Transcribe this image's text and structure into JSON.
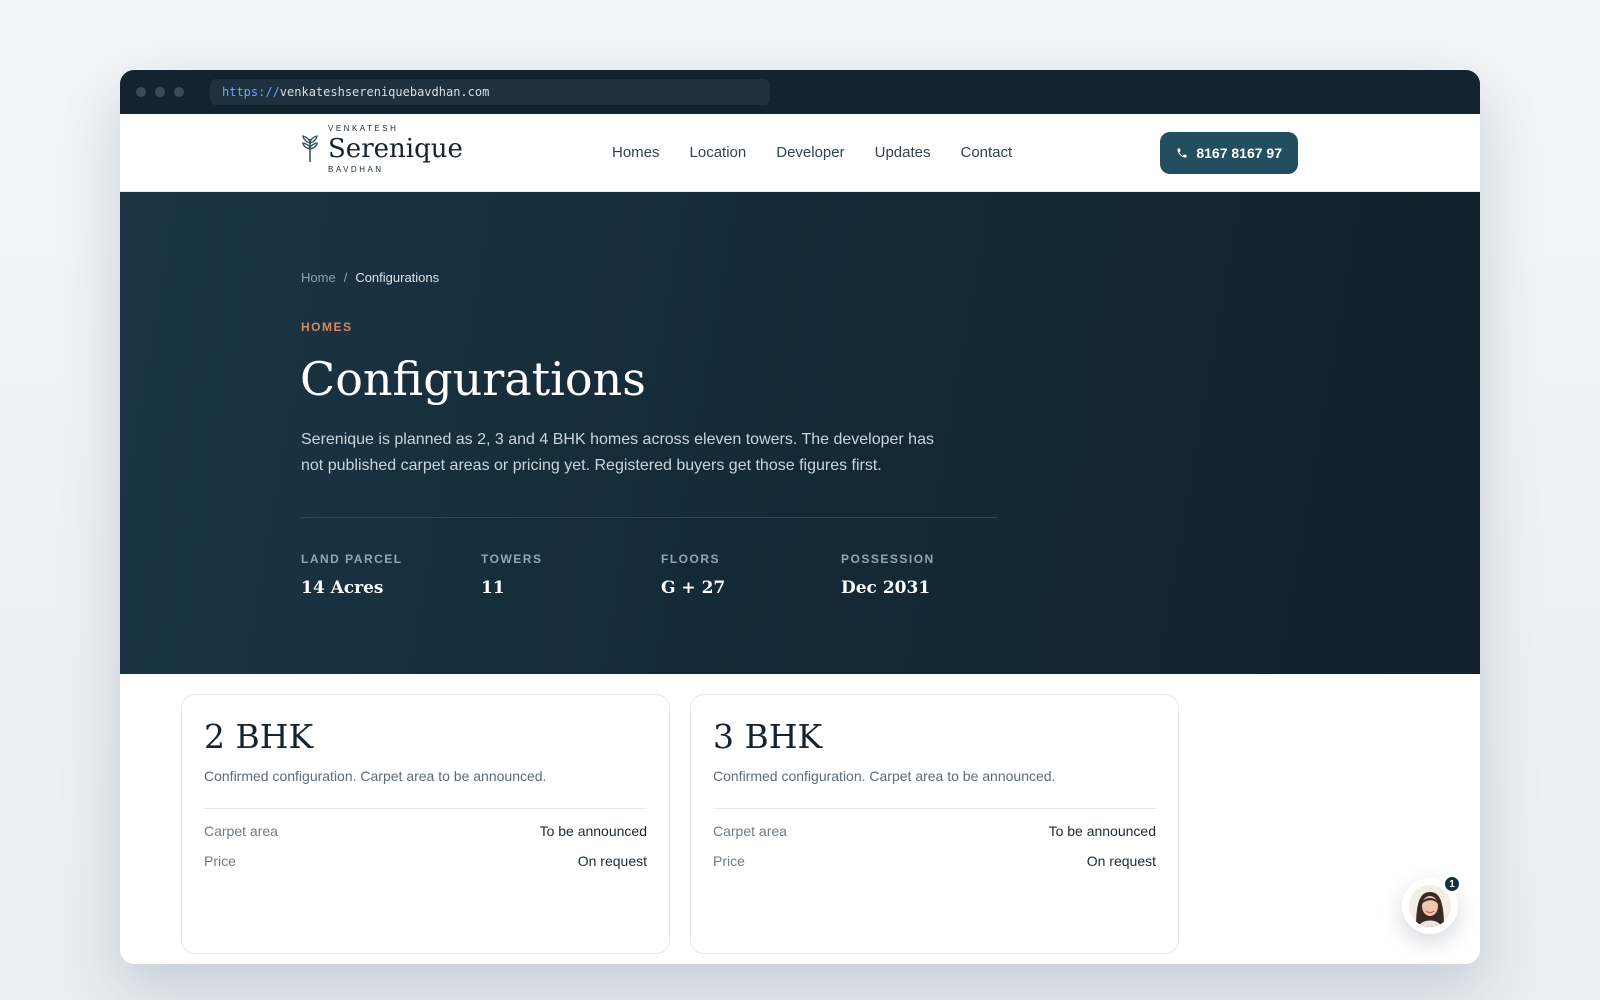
{
  "browser": {
    "url_scheme": "https://",
    "url_host": "venkateshsereniquebavdhan.com"
  },
  "brand": {
    "top": "VENKATESH",
    "name": "Serenique",
    "bottom": "BAVDHAN"
  },
  "nav": {
    "items": [
      "Homes",
      "Location",
      "Developer",
      "Updates",
      "Contact"
    ],
    "phone": "8167 8167 97"
  },
  "breadcrumb": {
    "home": "Home",
    "separator": "/",
    "current": "Configurations"
  },
  "hero": {
    "eyebrow": "HOMES",
    "title": "Configurations",
    "description": "Serenique is planned as 2, 3 and 4 BHK homes across eleven towers. The developer has not published carpet areas or pricing yet. Registered buyers get those figures first."
  },
  "stats": [
    {
      "label": "LAND PARCEL",
      "value": "14 Acres"
    },
    {
      "label": "TOWERS",
      "value": "11"
    },
    {
      "label": "FLOORS",
      "value": "G + 27"
    },
    {
      "label": "POSSESSION",
      "value": "Dec 2031"
    }
  ],
  "cards": [
    {
      "title": "2 BHK",
      "description": "Confirmed configuration. Carpet area to be announced.",
      "rows": [
        {
          "key": "Carpet area",
          "value": "To be announced"
        },
        {
          "key": "Price",
          "value": "On request"
        }
      ]
    },
    {
      "title": "3 BHK",
      "description": "Confirmed configuration. Carpet area to be announced.",
      "rows": [
        {
          "key": "Carpet area",
          "value": "To be announced"
        },
        {
          "key": "Price",
          "value": "On request"
        }
      ]
    }
  ],
  "chat": {
    "badge_count": "1"
  },
  "colors": {
    "hero_bg": "#142a38",
    "accent": "#d9875a",
    "button_bg": "#234e5f"
  }
}
